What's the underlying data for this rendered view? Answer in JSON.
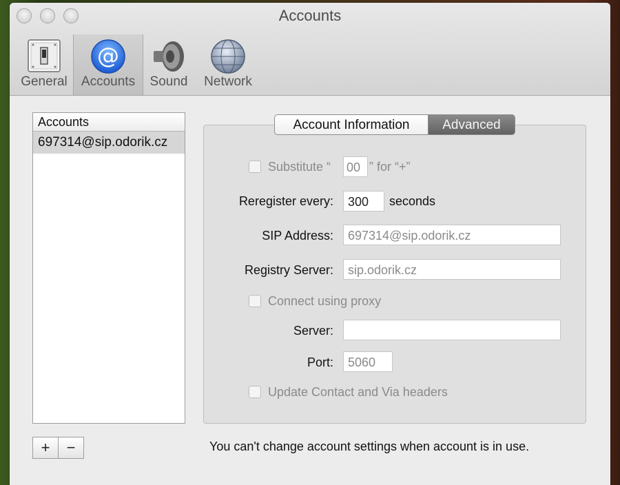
{
  "window": {
    "title": "Accounts"
  },
  "toolbar": {
    "items": [
      {
        "label": "General",
        "icon": "switch-icon",
        "selected": false
      },
      {
        "label": "Accounts",
        "icon": "at-sign-icon",
        "selected": true
      },
      {
        "label": "Sound",
        "icon": "speaker-icon",
        "selected": false
      },
      {
        "label": "Network",
        "icon": "globe-icon",
        "selected": false
      }
    ]
  },
  "accounts": {
    "header": "Accounts",
    "items": [
      {
        "label": "697314@sip.odorik.cz",
        "selected": true
      }
    ],
    "add_label": "+",
    "remove_label": "−"
  },
  "tabs": [
    {
      "label": "Account Information",
      "active": false
    },
    {
      "label": "Advanced",
      "active": true
    }
  ],
  "advanced": {
    "substitute": {
      "pre": "Substitute “",
      "value": "00",
      "post": "” for “+”",
      "checked": false
    },
    "reregister": {
      "label": "Reregister every:",
      "value": "300",
      "unit": "seconds"
    },
    "sip_address": {
      "label": "SIP Address:",
      "value": "697314@sip.odorik.cz"
    },
    "registry_server": {
      "label": "Registry Server:",
      "value": "sip.odorik.cz"
    },
    "proxy": {
      "label": "Connect using proxy",
      "checked": false
    },
    "server": {
      "label": "Server:",
      "value": ""
    },
    "port": {
      "label": "Port:",
      "value": "5060"
    },
    "update_headers": {
      "label": "Update Contact and Via headers",
      "checked": false
    }
  },
  "footer": {
    "message": "You can't change account settings when account is in use."
  },
  "colors": {
    "selected_tab": "#727272",
    "selected_toolbar": "#c8c8c8",
    "accent": "#2b78e4"
  }
}
